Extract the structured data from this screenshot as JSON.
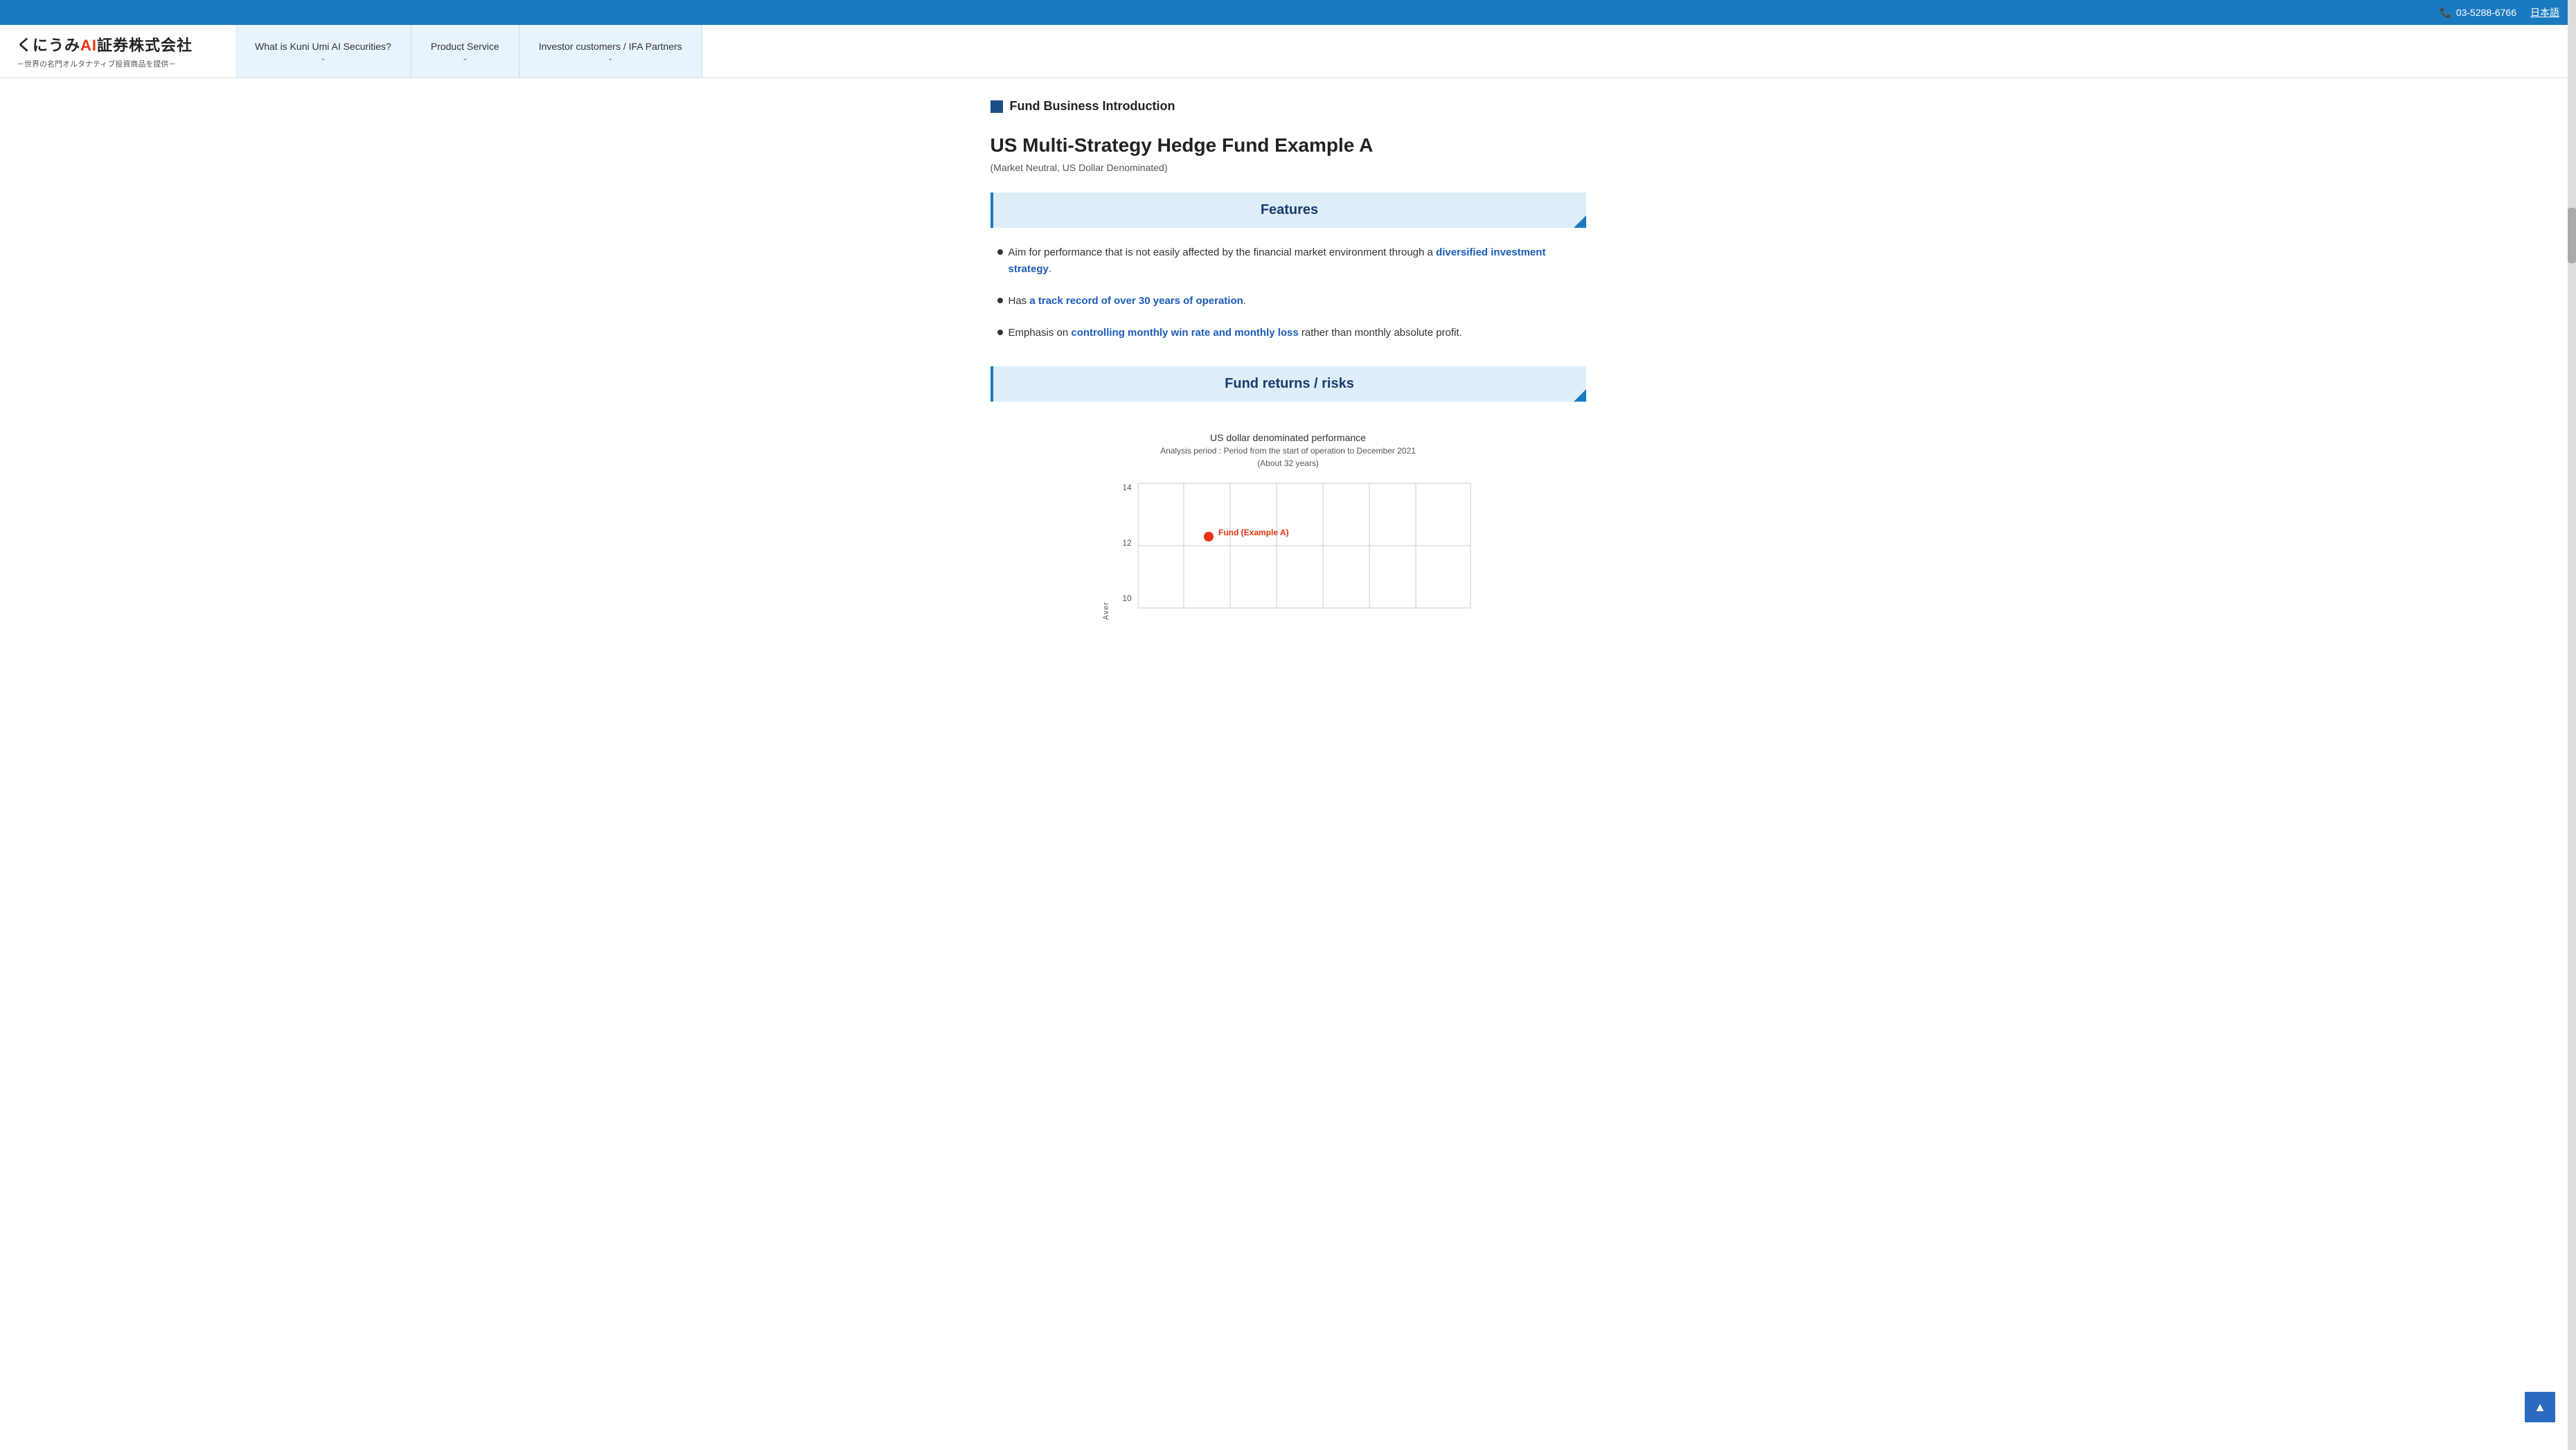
{
  "topbar": {
    "phone": "03-5288-6766",
    "language": "日本語",
    "phone_icon": "📞"
  },
  "logo": {
    "main_prefix": "くにうみ",
    "ai_text": "AI",
    "main_suffix": "証券株式会社",
    "sub": "－世界の名門オルタナティブ投資商品を提供－"
  },
  "nav": {
    "items": [
      {
        "label": "What is Kuni Umi AI Securities?",
        "has_chevron": true
      },
      {
        "label": "Product Service",
        "has_chevron": true
      },
      {
        "label": "Investor customers / IFA Partners",
        "has_chevron": true
      }
    ]
  },
  "page": {
    "breadcrumb_icon": "▪",
    "section_label": "Fund Business Introduction",
    "fund_title": "US Multi-Strategy Hedge Fund Example A",
    "fund_subtitle": "(Market Neutral, US Dollar Denominated)",
    "features_header": "Features",
    "features": [
      {
        "text_before": "Aim for performance that is not easily affected by the financial market environment through a ",
        "link_text": "diversified investment strategy",
        "text_after": "."
      },
      {
        "text_before": "Has ",
        "link_text": "a track record of over 30 years of operation",
        "text_after": "."
      },
      {
        "text_before": "Emphasis on ",
        "link_text": "controlling monthly win rate and monthly loss",
        "text_after": " rather than monthly absolute profit."
      }
    ],
    "fund_returns_header": "Fund returns / risks",
    "chart_title": "US dollar denominated performance",
    "chart_subtitle": "Analysis period : Period from the start of operation to December 2021",
    "chart_subtitle2": "(About 32 years)",
    "chart_y_label": "Aver",
    "chart_y_max": 14,
    "chart_y_mid": 12,
    "chart_y_min": 10,
    "fund_label": "Fund  (Example A)",
    "back_to_top": "▲"
  }
}
